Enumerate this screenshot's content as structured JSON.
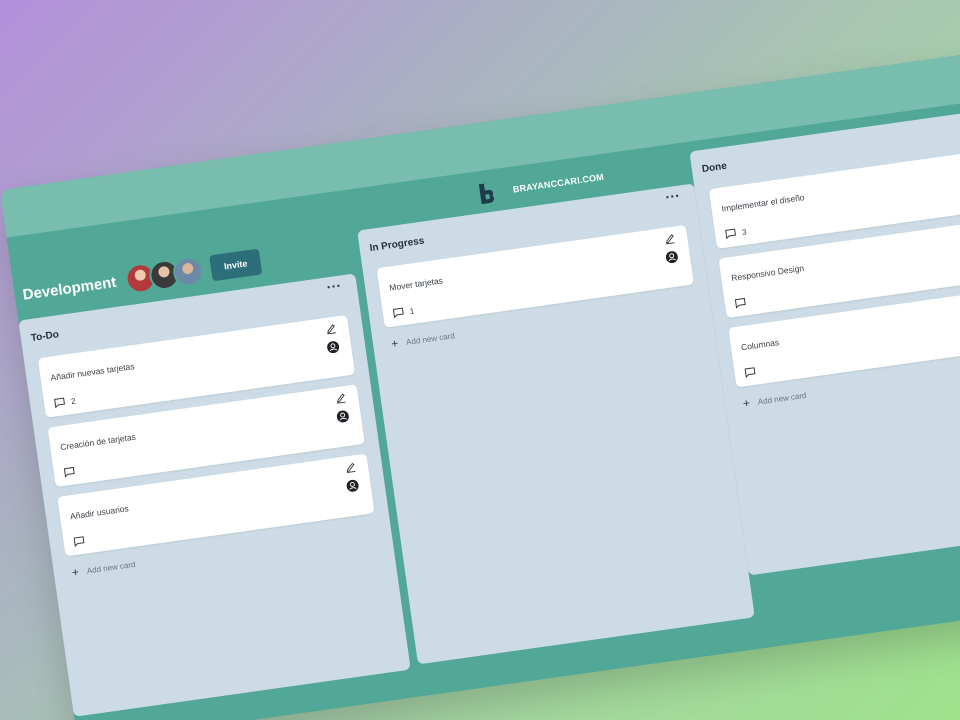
{
  "header": {
    "brand_name": "BRAYANCCARI.COM",
    "logo_icon": "b-letter-logo-icon"
  },
  "board": {
    "title": "Development",
    "invite_label": "Invite",
    "avatars": [
      "avatar-1",
      "avatar-2",
      "avatar-3"
    ]
  },
  "columns": [
    {
      "title": "To-Do",
      "more_label": "...",
      "add_card_label": "Add new card",
      "cards": [
        {
          "title": "Añadir nuevas tarjetas",
          "comments": "2"
        },
        {
          "title": "Creación de tarjetas",
          "comments": ""
        },
        {
          "title": "Añadir usuarios",
          "comments": ""
        }
      ]
    },
    {
      "title": "In Progress",
      "more_label": "...",
      "add_card_label": "Add new card",
      "cards": [
        {
          "title": "Mover tarjetas",
          "comments": "1"
        }
      ]
    },
    {
      "title": "Done",
      "more_label": "...",
      "add_card_label": "Add new card",
      "cards": [
        {
          "title": "Implementar el diseño",
          "comments": "3"
        },
        {
          "title": "Responsivo Design",
          "comments": ""
        },
        {
          "title": "Columnas",
          "comments": ""
        }
      ]
    }
  ],
  "colors": {
    "frame": "#52a896",
    "topbar": "#78bdae",
    "column": "#ccdbe5",
    "invite": "#2c6f7a"
  }
}
